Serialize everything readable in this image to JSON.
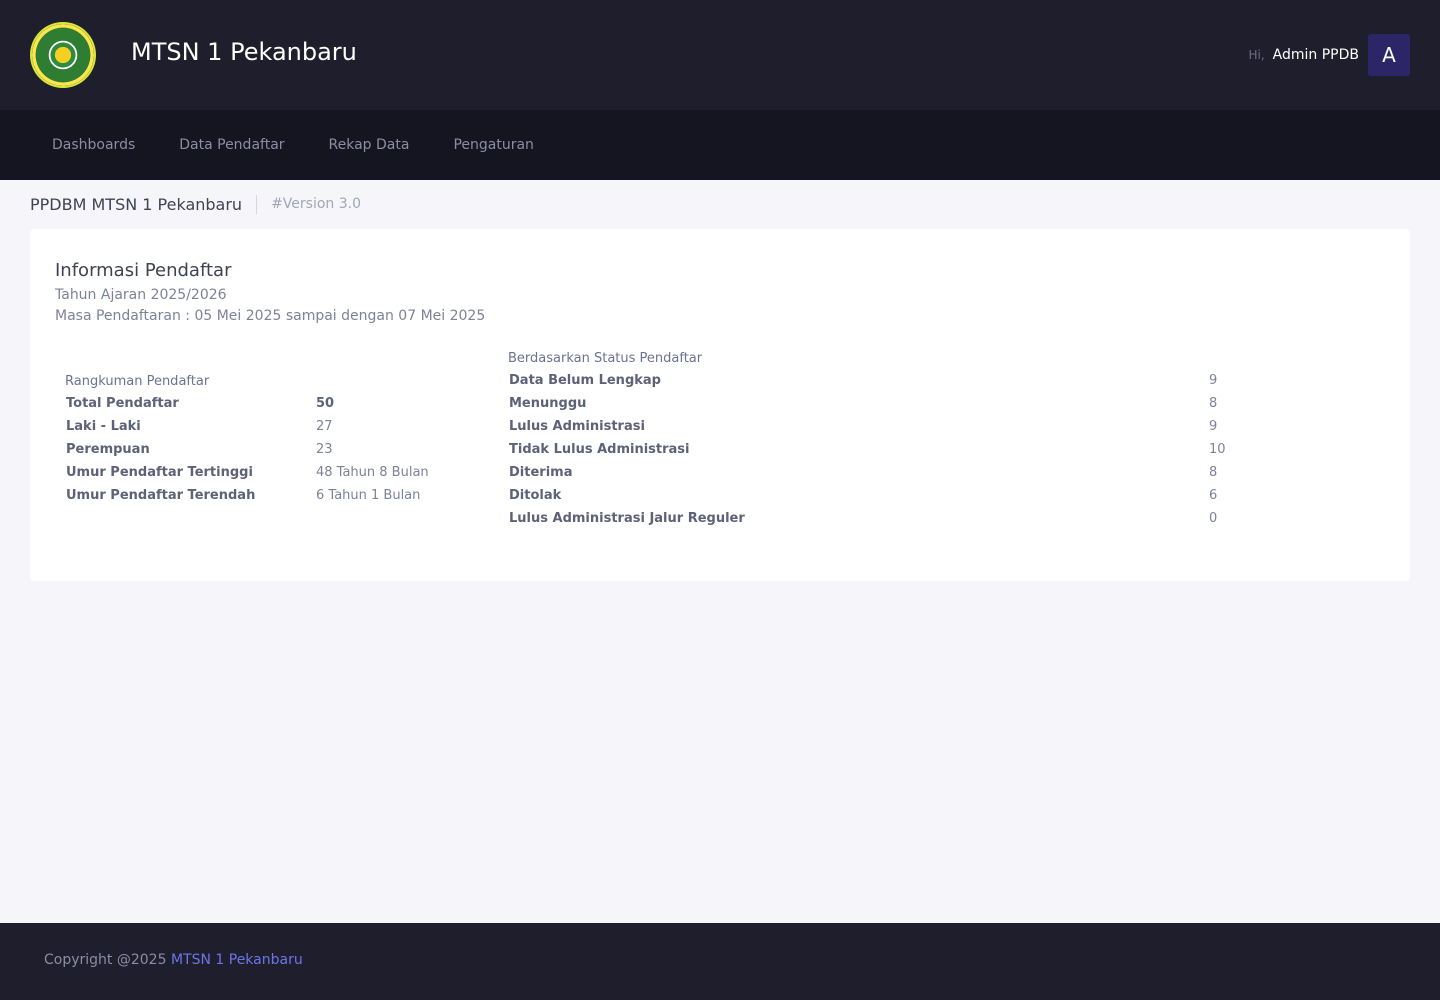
{
  "header": {
    "brand_title": "MTSN 1 Pekanbaru",
    "greeting": "Hi,",
    "user_name": "Admin PPDB",
    "avatar_letter": "A"
  },
  "nav": {
    "items": [
      {
        "label": "Dashboards"
      },
      {
        "label": "Data Pendaftar"
      },
      {
        "label": "Rekap Data"
      },
      {
        "label": "Pengaturan"
      }
    ]
  },
  "subheader": {
    "title": "PPDBM MTSN 1 Pekanbaru",
    "version": "#Version 3.0"
  },
  "info_card": {
    "title": "Informasi Pendaftar",
    "academic_year": "Tahun Ajaran 2025/2026",
    "registration_period": "Masa Pendaftaran : 05 Mei 2025 sampai dengan 07 Mei 2025",
    "summary": {
      "heading": "Rangkuman Pendaftar",
      "rows": [
        {
          "label": "Total Pendaftar",
          "value": "50"
        },
        {
          "label": "Laki - Laki",
          "value": "27"
        },
        {
          "label": "Perempuan",
          "value": "23"
        },
        {
          "label": "Umur Pendaftar Tertinggi",
          "value": "48 Tahun 8 Bulan"
        },
        {
          "label": "Umur Pendaftar Terendah",
          "value": "6 Tahun 1 Bulan"
        }
      ]
    },
    "status": {
      "heading": "Berdasarkan Status Pendaftar",
      "rows": [
        {
          "label": "Data Belum Lengkap",
          "value": "9"
        },
        {
          "label": "Menunggu",
          "value": "8"
        },
        {
          "label": "Lulus Administrasi",
          "value": "9"
        },
        {
          "label": "Tidak Lulus Administrasi",
          "value": "10"
        },
        {
          "label": "Diterima",
          "value": "8"
        },
        {
          "label": "Ditolak",
          "value": "6"
        },
        {
          "label": "Lulus Administrasi Jalur Reguler",
          "value": "0"
        }
      ]
    }
  },
  "footer": {
    "copyright_prefix": "Copyright @2025",
    "copyright_link": "MTSN 1 Pekanbaru"
  },
  "colors": {
    "header_bg": "#1e1e2d",
    "nav_bg": "#151521",
    "avatar_bg": "#2c2669",
    "link": "#6e74e8"
  }
}
